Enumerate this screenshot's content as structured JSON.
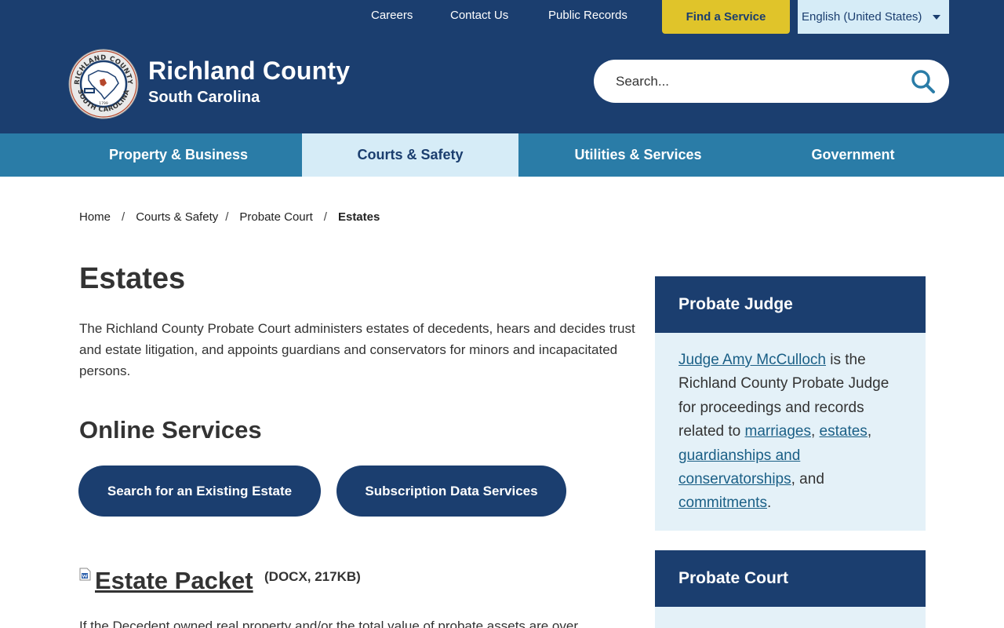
{
  "utility": {
    "links": [
      "Careers",
      "Contact Us",
      "Public Records"
    ],
    "find_service": "Find a Service",
    "language": "English (United States)"
  },
  "header": {
    "county": "Richland County",
    "state": "South Carolina",
    "seal_text_top": "RICHLAND COUNTY",
    "seal_text_bottom": "SOUTH CAROLINA",
    "seal_year": "1799",
    "search_placeholder": "Search..."
  },
  "nav": {
    "items": [
      "Property & Business",
      "Courts & Safety",
      "Utilities & Services",
      "Government"
    ],
    "active": "Courts & Safety"
  },
  "breadcrumb": {
    "items": [
      "Home",
      "Courts & Safety",
      "Probate Court"
    ],
    "separator": "/",
    "current": "Estates"
  },
  "main": {
    "title": "Estates",
    "intro": "The Richland County Probate Court administers estates of decedents, hears and decides trust and estate litigation, and appoints guardians and conservators for minors and incapacitated persons.",
    "online_services_title": "Online Services",
    "buttons": [
      "Search for an Existing Estate",
      "Subscription Data Services"
    ],
    "packet_link": "Estate Packet",
    "packet_meta": "(DOCX, 217KB)",
    "cut_text": "If the Decedent owned real property and/or the total value of probate assets are over"
  },
  "sidebar": {
    "judge_heading": "Probate Judge",
    "judge_link": "Judge Amy McCulloch",
    "judge_text_1": " is the Richland County Probate Judge for proceedings and records related to ",
    "link_marriages": "marriages",
    "comma_1": ", ",
    "link_estates": "estates",
    "comma_2": ", ",
    "link_guardianships": "guardianships and conservatorships",
    "and_text": ", and ",
    "link_commitments": "commitments",
    "period": ".",
    "court_heading": "Probate Court"
  },
  "colors": {
    "navy": "#1b3e6f",
    "nav_blue": "#2a7ca7",
    "light_blue": "#d6ecf7",
    "sidebar_bg": "#e4f1f8",
    "gold": "#e0c42a",
    "link": "#1a5f86"
  }
}
